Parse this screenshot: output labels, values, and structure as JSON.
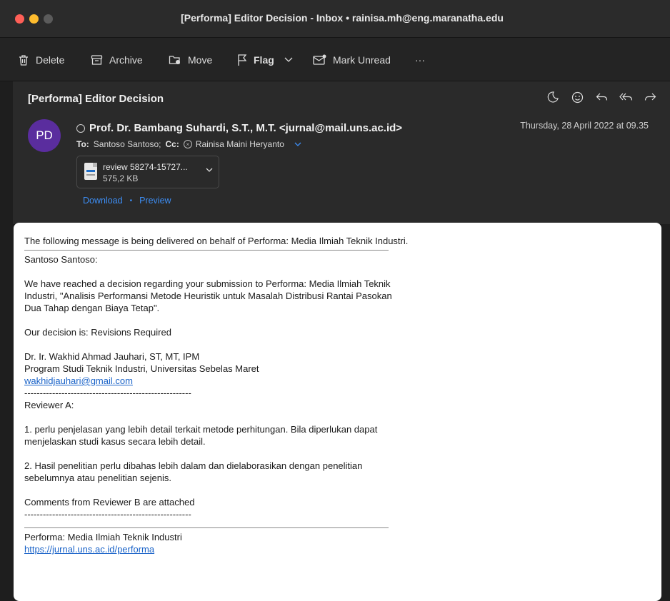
{
  "window": {
    "title": "[Performa] Editor Decision - Inbox • rainisa.mh@eng.maranatha.edu"
  },
  "toolbar": {
    "delete": "Delete",
    "archive": "Archive",
    "move": "Move",
    "flag": "Flag",
    "mark_unread": "Mark Unread",
    "more": "···"
  },
  "email": {
    "subject": "[Performa] Editor Decision",
    "avatar_initials": "PD",
    "from": "Prof. Dr. Bambang Suhardi, S.T., M.T. <jurnal@mail.uns.ac.id>",
    "date": "Thursday, 28 April 2022 at 09.35",
    "to_label": "To:",
    "to_value": "Santoso Santoso;",
    "cc_label": "Cc:",
    "cc_value": "Rainisa Maini Heryanto",
    "attachment": {
      "name": "review 58274-15727...",
      "size": "575,2 KB"
    },
    "download": "Download",
    "preview": "Preview"
  },
  "body": {
    "intro": "The following message is being delivered on behalf of Performa: Media Ilmiah Teknik Industri.",
    "salutation": "Santoso Santoso:",
    "decision_para": "We have reached a decision regarding your submission to Performa: Media Ilmiah Teknik Industri, \"Analisis Performansi Metode Heuristik untuk Masalah Distribusi Rantai Pasokan Dua Tahap dengan Biaya Tetap\".",
    "decision": "Our decision is: Revisions Required",
    "signer_name": "Dr. Ir. Wakhid Ahmad Jauhari, ST,  MT, IPM",
    "signer_affiliation": "Program Studi Teknik Industri, Universitas Sebelas Maret",
    "signer_email": "wakhidjauhari@gmail.com",
    "dash_line": "------------------------------------------------------",
    "reviewer_a": "Reviewer A:",
    "comment_1": "1. perlu penjelasan yang lebih detail terkait metode perhitungan. Bila diperlukan dapat menjelaskan studi kasus secara lebih detail.",
    "comment_2": "2. Hasil penelitian perlu dibahas lebih dalam dan dielaborasikan dengan penelitian sebelumnya atau penelitian sejenis.",
    "reviewer_b": "Comments from Reviewer B are attached",
    "dash_line_2": "------------------------------------------------------",
    "footer_name": "Performa: Media Ilmiah Teknik Industri",
    "footer_url": "https://jurnal.uns.ac.id/performa"
  }
}
